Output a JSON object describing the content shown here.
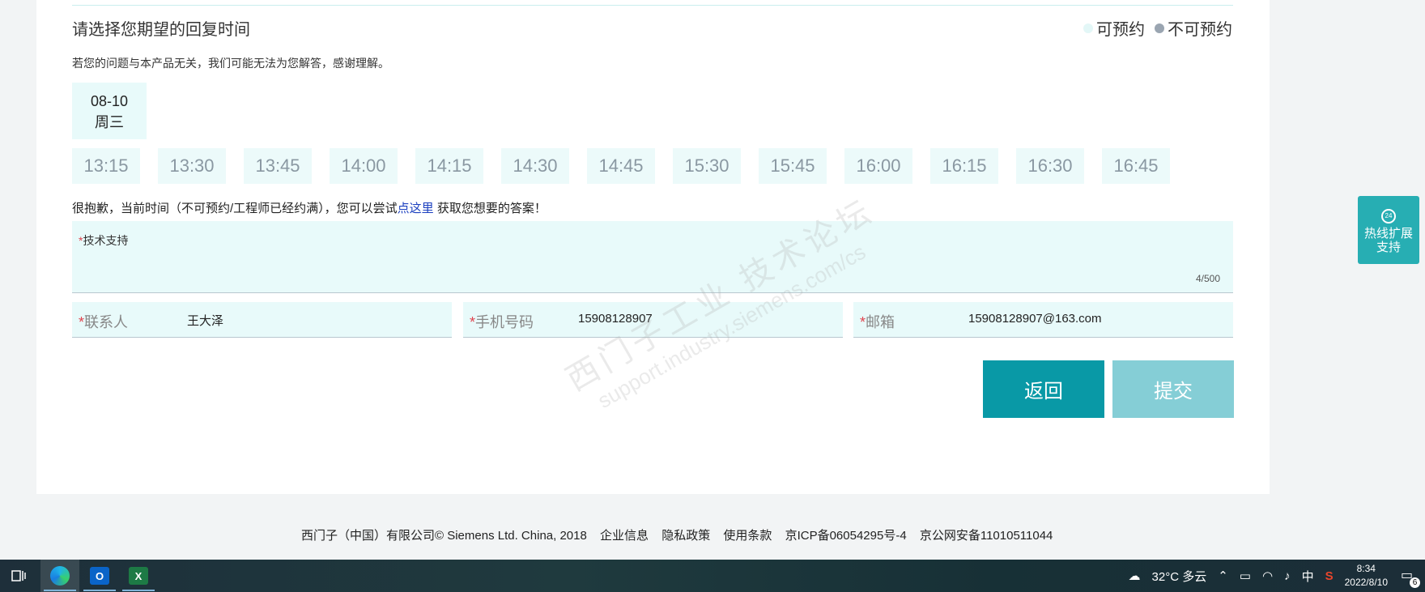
{
  "section": {
    "title": "请选择您期望的回复时间",
    "legend_available": "可预约",
    "legend_unavailable": "不可预约",
    "notice": "若您的问题与本产品无关，我们可能无法为您解答，感谢理解。"
  },
  "date": {
    "day": "08-10",
    "weekday": "周三"
  },
  "slots": [
    "13:15",
    "13:30",
    "13:45",
    "14:00",
    "14:15",
    "14:30",
    "14:45",
    "15:30",
    "15:45",
    "16:00",
    "16:15",
    "16:30",
    "16:45"
  ],
  "sorry": {
    "before": "很抱歉，当前时间（不可预约/工程师已经约满），您可以尝试",
    "link": "点这里",
    "after": " 获取您想要的答案！"
  },
  "form": {
    "topic_required": "*",
    "topic_label": "技术支持",
    "counter": "4/500",
    "contact_label": "联系人",
    "contact_value": "王大泽",
    "phone_label": "手机号码",
    "phone_value": "15908128907",
    "email_label": "邮箱",
    "email_value": "15908128907@163.com",
    "required_mark": "*"
  },
  "buttons": {
    "back": "返回",
    "submit": "提交"
  },
  "watermark": {
    "line1": "西门子工业  技术论坛",
    "line2": "support.industry.siemens.com/cs"
  },
  "float_support": {
    "label_line1": "热线扩展",
    "label_line2": "支持",
    "badge": "24"
  },
  "footer": {
    "copyright": "西门子（中国）有限公司© Siemens Ltd. China, 2018",
    "links": [
      "企业信息",
      "隐私政策",
      "使用条款",
      "京ICP备06054295号-4",
      "京公网安备11010511044"
    ]
  },
  "taskbar": {
    "weather": "32°C  多云",
    "ime": "中",
    "time": "8:34",
    "date": "2022/8/10",
    "notifications": "6",
    "outlook_letter": "O",
    "excel_letter": "X"
  },
  "colors": {
    "accent": "#0999a6",
    "submit_disabled": "#85ced6",
    "slot_bg": "#ecfafa",
    "link": "#1b3fbf"
  }
}
